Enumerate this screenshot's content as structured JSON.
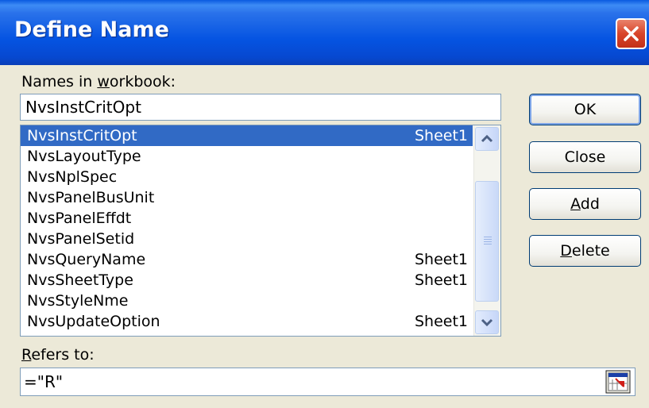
{
  "window": {
    "title": "Define Name"
  },
  "names_label": {
    "before": "Names in ",
    "underlined": "w",
    "after": "orkbook:"
  },
  "name_input": {
    "value": "NvsInstCritOpt"
  },
  "names_list": [
    {
      "name": "NvsInstCritOpt",
      "sheet": "Sheet1",
      "selected": true
    },
    {
      "name": "NvsLayoutType",
      "sheet": ""
    },
    {
      "name": "NvsNplSpec",
      "sheet": ""
    },
    {
      "name": "NvsPanelBusUnit",
      "sheet": ""
    },
    {
      "name": "NvsPanelEffdt",
      "sheet": ""
    },
    {
      "name": "NvsPanelSetid",
      "sheet": ""
    },
    {
      "name": "NvsQueryName",
      "sheet": "Sheet1"
    },
    {
      "name": "NvsSheetType",
      "sheet": "Sheet1"
    },
    {
      "name": "NvsStyleNme",
      "sheet": ""
    },
    {
      "name": "NvsUpdateOption",
      "sheet": "Sheet1"
    }
  ],
  "buttons": {
    "ok": {
      "label": "OK"
    },
    "close": {
      "label": "Close"
    },
    "add": {
      "underlined": "A",
      "rest": "dd"
    },
    "delete": {
      "underlined": "D",
      "rest": "elete"
    }
  },
  "refers_label": {
    "underlined": "R",
    "rest": "efers to:"
  },
  "refers_input": {
    "value": "=\"R\""
  },
  "icons": [
    "close-icon",
    "scroll-up-icon",
    "scroll-down-icon",
    "collapse-dialog-icon"
  ],
  "colors": {
    "title_bar": "#0554e2",
    "selection": "#316ac5",
    "dialog_bg": "#ece9d8",
    "close_button": "#d8452a"
  }
}
